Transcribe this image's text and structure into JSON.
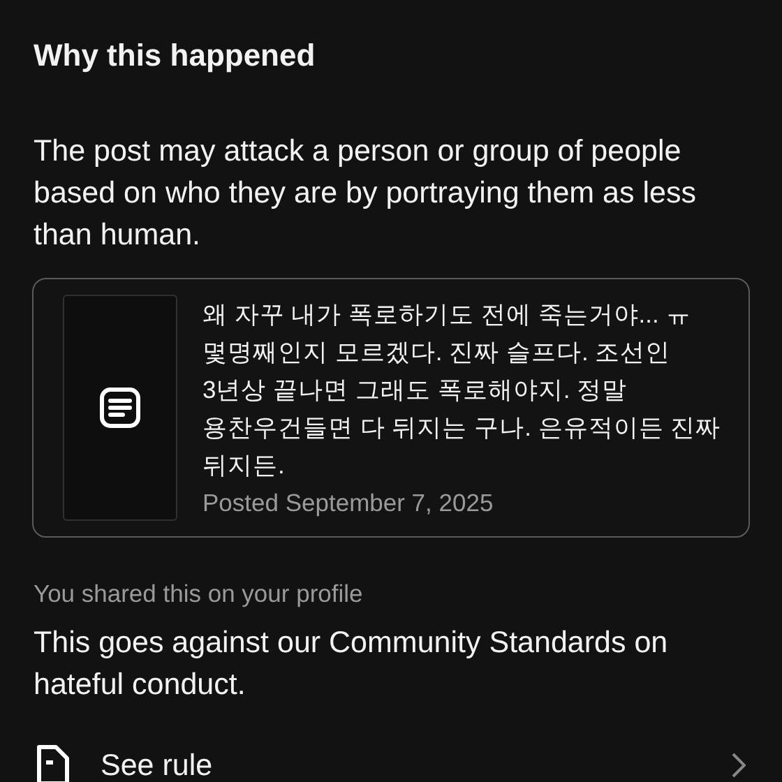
{
  "heading": "Why this happened",
  "reason": "The post may attack a person or group of people based on who they are by portraying them as less than human.",
  "post": {
    "text": "왜 자꾸 내가 폭로하기도 전에 죽는거야... ㅠ 몇명째인지 모르겠다. 진짜 슬프다. 조선인 3년상 끝나면 그래도 폭로해야지. 정말 용찬우건들면 다 뒤지는 구나. 은유적이든 진짜 뒤지든.",
    "date": "Posted September 7, 2025"
  },
  "shared_note": "You shared this on your profile",
  "standards": "This goes against our Community Standards on hateful conduct.",
  "link": {
    "label": "See rule"
  }
}
